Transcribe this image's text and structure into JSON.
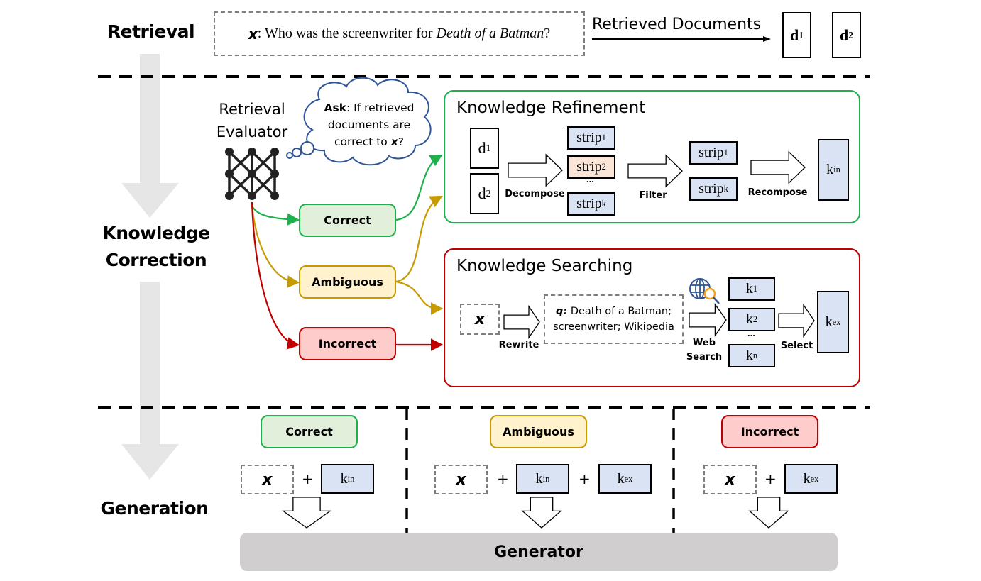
{
  "stages": {
    "retrieval": "Retrieval",
    "correction_line1": "Knowledge",
    "correction_line2": "Correction",
    "generation": "Generation"
  },
  "retrieval": {
    "query_symbol": "x",
    "query_prefix": ": Who was the screenwriter for ",
    "query_title": "Death of a Batman",
    "query_suffix": "?",
    "arrow_label": "Retrieved Documents",
    "docs": [
      {
        "base": "d",
        "sub": "1"
      },
      {
        "base": "d",
        "sub": "2"
      }
    ]
  },
  "evaluator": {
    "label_line1": "Retrieval",
    "label_line2": "Evaluator",
    "thought_bold": "Ask",
    "thought_line1": ": If retrieved",
    "thought_line2": "documents are",
    "thought_line3_prefix": "correct to ",
    "thought_line3_symbol": "x",
    "thought_line3_suffix": "?"
  },
  "judgements": {
    "correct": "Correct",
    "ambiguous": "Ambiguous",
    "incorrect": "Incorrect"
  },
  "refinement": {
    "title": "Knowledge Refinement",
    "docs": [
      {
        "base": "d",
        "sub": "1"
      },
      {
        "base": "d",
        "sub": "2"
      }
    ],
    "decompose_label": "Decompose",
    "strips": [
      {
        "base": "strip",
        "sub": "1",
        "highlight": false
      },
      {
        "base": "strip",
        "sub": "2",
        "highlight": true
      },
      {
        "base": "strip",
        "sub": "k",
        "highlight": false
      }
    ],
    "ellipsis": "...",
    "filter_label": "Filter",
    "filtered_strips": [
      {
        "base": "strip",
        "sub": "1"
      },
      {
        "base": "strip",
        "sub": "k"
      }
    ],
    "recompose_label": "Recompose",
    "output": {
      "base": "k",
      "sub": "in"
    }
  },
  "searching": {
    "title": "Knowledge Searching",
    "input_symbol": "x",
    "rewrite_label": "Rewrite",
    "query_prefix": "q:",
    "query_line1": " Death of a Batman;",
    "query_line2": "screenwriter; Wikipedia",
    "web_search_line1": "Web",
    "web_search_line2": "Search",
    "results": [
      {
        "base": "k",
        "sub": "1"
      },
      {
        "base": "k",
        "sub": "2"
      },
      {
        "base": "k",
        "sub": "n"
      }
    ],
    "ellipsis": "...",
    "select_label": "Select",
    "output": {
      "base": "k",
      "sub": "ex"
    }
  },
  "generation": {
    "columns": [
      {
        "label": "Correct",
        "symbol": "x",
        "parts": [
          {
            "base": "k",
            "sub": "in"
          }
        ]
      },
      {
        "label": "Ambiguous",
        "symbol": "x",
        "parts": [
          {
            "base": "k",
            "sub": "in"
          },
          {
            "base": "k",
            "sub": "ex"
          }
        ]
      },
      {
        "label": "Incorrect",
        "symbol": "x",
        "parts": [
          {
            "base": "k",
            "sub": "ex"
          }
        ]
      }
    ],
    "plus": "+",
    "generator_label": "Generator"
  },
  "colors": {
    "correct_border": "#1db04b",
    "correct_fill": "#e2efda",
    "ambiguous_border": "#c79a00",
    "ambiguous_fill": "#fff2cc",
    "incorrect_border": "#c00000",
    "incorrect_fill": "#ffcccc",
    "knowledge_fill": "#dae3f3",
    "highlight_strip_fill": "#fbe5d6",
    "thought_border": "#2f5597",
    "generator_fill": "#d0cece"
  }
}
